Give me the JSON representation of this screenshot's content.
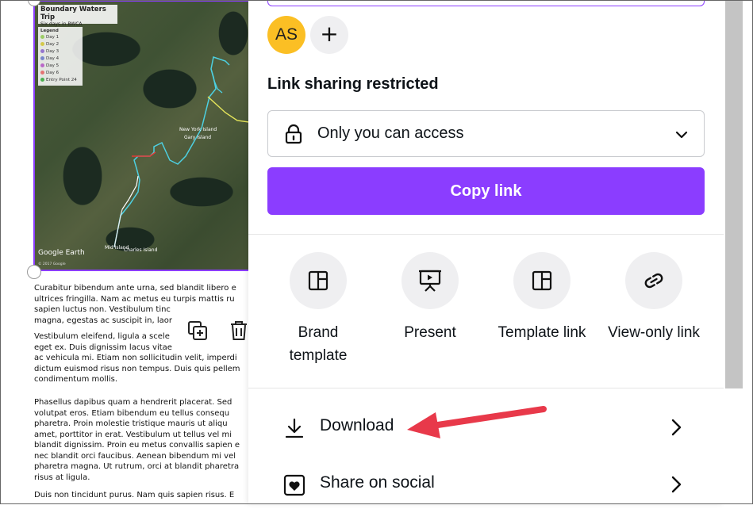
{
  "document": {
    "map": {
      "title": "Boundary Waters Trip",
      "subtitle": "Six days in BWCA",
      "legend_title": "Legend",
      "legend_items": [
        {
          "label": "Day 1",
          "color": "#9ccc65"
        },
        {
          "label": "Day 2",
          "color": "#d4c94a"
        },
        {
          "label": "Day 3",
          "color": "#9575cd"
        },
        {
          "label": "Day 4",
          "color": "#7986cb"
        },
        {
          "label": "Day 5",
          "color": "#ba68c8"
        },
        {
          "label": "Day 6",
          "color": "#e57373"
        },
        {
          "label": "Entry Point 24",
          "color": "#4caf50"
        }
      ],
      "place_labels": [
        "New York Island",
        "Gary Island",
        "Charles Island"
      ],
      "mid_island": "Mid Island",
      "watermark": "Google Earth",
      "copyright": "© 2017 Google"
    },
    "paragraphs": [
      [
        "Curabitur bibendum ante urna, sed blandit libero e",
        "ultrices fringilla. Nam ac metus eu turpis mattis ru",
        "sapien luctus non. Vestibulum tinc",
        "magna, egestas ac suscipit in, laor"
      ],
      [
        "Vestibulum eleifend, ligula a scele",
        "eget ex. Duis dignissim lacus vitae",
        "ac vehicula mi. Etiam non sollicitudin velit, imperdi",
        "dictum euismod risus non tempus. Duis quis pellem",
        "condimentum mollis."
      ],
      [
        "Phasellus dapibus quam a hendrerit placerat. Sed",
        "volutpat eros. Etiam bibendum eu tellus consequ",
        "pharetra. Proin molestie tristique mauris ut aliqu",
        "amet, porttitor in erat. Vestibulum ut tellus vel mi",
        "blandit dignissim. Proin eu metus convallis sapien e",
        "nec blandit orci faucibus. Aenean bibendum mi vel",
        "pharetra magna. Ut rutrum, orci at blandit pharetra",
        "risus at ligula."
      ],
      [
        "Duis non tincidunt purus. Nam quis sapien risus. E"
      ]
    ]
  },
  "share_panel": {
    "avatar_initials": "AS",
    "add_people_symbol": "+",
    "link_section_title": "Link sharing restricted",
    "access_select_value": "Only you can access",
    "copy_link_label": "Copy link",
    "options": [
      {
        "label_lines": [
          "Brand",
          "template"
        ],
        "icon": "layout-icon"
      },
      {
        "label_lines": [
          "Present"
        ],
        "icon": "presentation-icon"
      },
      {
        "label_lines": [
          "Template link"
        ],
        "icon": "layout-icon"
      },
      {
        "label_lines": [
          "View-only link"
        ],
        "icon": "link-icon"
      }
    ],
    "rows": [
      {
        "label": "Download",
        "icon": "download-icon"
      },
      {
        "label": "Share on social",
        "icon": "heart-icon"
      }
    ]
  },
  "colors": {
    "accent": "#8b3dff",
    "avatar": "#fbbf24",
    "annotation_arrow": "#e8394a"
  }
}
